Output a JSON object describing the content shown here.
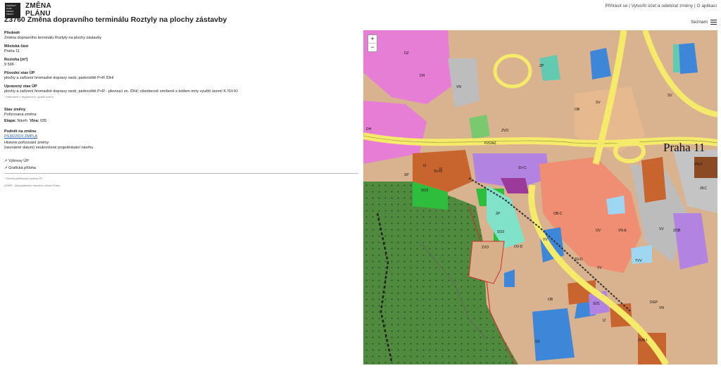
{
  "header": {
    "logo_lines": [
      "PRAŽSKÝ",
      "PLÁN",
      "PRAHA",
      "PRAHY"
    ],
    "logo_title_1": "ZMĚNA",
    "logo_title_2": "PLÁNU",
    "page_title": "Z3760 Změna dopravního terminálu Roztyly na plochy zástavby",
    "links": {
      "login": "Přihlásit se",
      "sep1": " | ",
      "register": "Vytvořit účet a odebírat změny",
      "sep2": " | ",
      "about": "O aplikaci"
    },
    "list_label": "Seznam"
  },
  "detail": {
    "predmet_label": "Předmět",
    "predmet_value": "Změna dopravního terminálu Roztyly na plochy zástavby",
    "mestska_label": "Městská část",
    "mestska_value": "Praha 11",
    "rozloha_label": "Rozloha [m²]",
    "rozloha_value": "9 596",
    "puvodni_label": "Původní stav ÚP",
    "puvodni_value": "plochy a zařízení hromadné dopravy osob, parkoviště P+R /DH/",
    "upraveny_label": "Upravený stav ÚP",
    "upraveny_value": "plochy a zařízení hromadné dopravy osob, parkoviště P+R - plovoucí zn. /DH/; všeobecně smíšené s kódem míry využití území K /SV-K/",
    "upraveny_note": "* informace o regulačních využití území",
    "stav_label": "Stav změny",
    "stav_value": "Pořizovaná změna",
    "etapa_label": "Etapa:",
    "etapa_value": "Návrh",
    "vlna_label": "Vlna:",
    "vlna_value": "035",
    "podnet_label": "Podnět na změnu",
    "podnet_value": "PS36/2019 ZMPLA",
    "historie_label": "Historie pořizování změny",
    "historie_value": "(neznámé datum) neukončené projednávání návrhu",
    "vykresy": "↗ Výkresy ÚP",
    "graficka": "↗ Grafická příloha",
    "footer_note": "* Změna pořizování změny ÚP",
    "footer_org": "ZHMP - Zastupitelstvo hlavního města Prahy"
  },
  "map": {
    "zoom_in": "+",
    "zoom_out": "−",
    "district_label": "Praha 11",
    "zone_labels": [
      "DZ",
      "DH",
      "DH",
      "ZP",
      "VN",
      "OB",
      "SV",
      "SV",
      "IZ",
      "IZ",
      "ZVO",
      "PZOAZ",
      "SV-G",
      "SO3",
      "SP",
      "ZP",
      "SO3",
      "ZVO",
      "SV-C",
      "OB-C",
      "VN-E",
      "OV",
      "VV",
      "VV",
      "ZOB",
      "VN-F",
      "ZKC",
      "SV-D",
      "TVV",
      "VV",
      "OB",
      "SO1",
      "ZOB-I",
      "IZ",
      "OV-D",
      "VV",
      "VN",
      "DGP"
    ]
  }
}
